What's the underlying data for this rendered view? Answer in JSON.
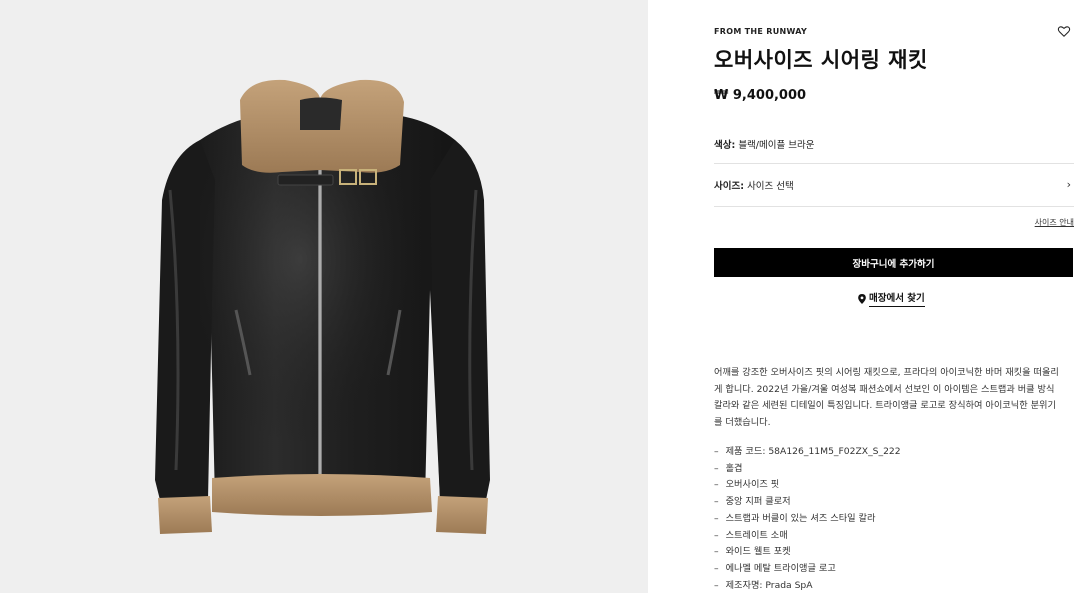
{
  "product": {
    "eyebrow": "FROM THE RUNWAY",
    "title": "오버사이즈 시어링 재킷",
    "price": "₩ 9,400,000",
    "color_label": "색상:",
    "color_value": "블랙/메이플 브라운",
    "size_label": "사이즈:",
    "size_value": "사이즈 선택",
    "size_guide": "사이즈 안내",
    "add_to_cart": "장바구니에 추가하기",
    "find_in_store": "매장에서 찾기",
    "description": "어깨를 강조한 오버사이즈 핏의 시어링 재킷으로, 프라다의 아이코닉한 바머 재킷을 떠올리게 합니다. 2022년 가을/겨울 여성복 패션쇼에서 선보인 이 아이템은 스트랩과 버클 방식 칼라와 같은 세련된 디테일이 특징입니다. 트라이앵글 로고로 장식하여 아이코닉한 분위기를 더했습니다.",
    "features": [
      "제품 코드: 58A126_11M5_F02ZX_S_222",
      "홀겹",
      "오버사이즈 핏",
      "중앙 지퍼 클로저",
      "스트랩과 버클이 있는 셔즈 스타일 칼라",
      "스트레이트 소매",
      "와이드 웰트 포켓",
      "에나멜 메탈 트라이앵글 로고",
      "제조자명: Prada SpA"
    ]
  },
  "colors": {
    "gallery_bg": "#efefef",
    "leather": "#1c1c1c",
    "shearling": "#b08e68",
    "button_bg": "#000000"
  },
  "icons": {
    "wishlist": "heart-outline-icon",
    "size_chevron": "chevron-right-icon",
    "store": "location-pin-icon"
  }
}
